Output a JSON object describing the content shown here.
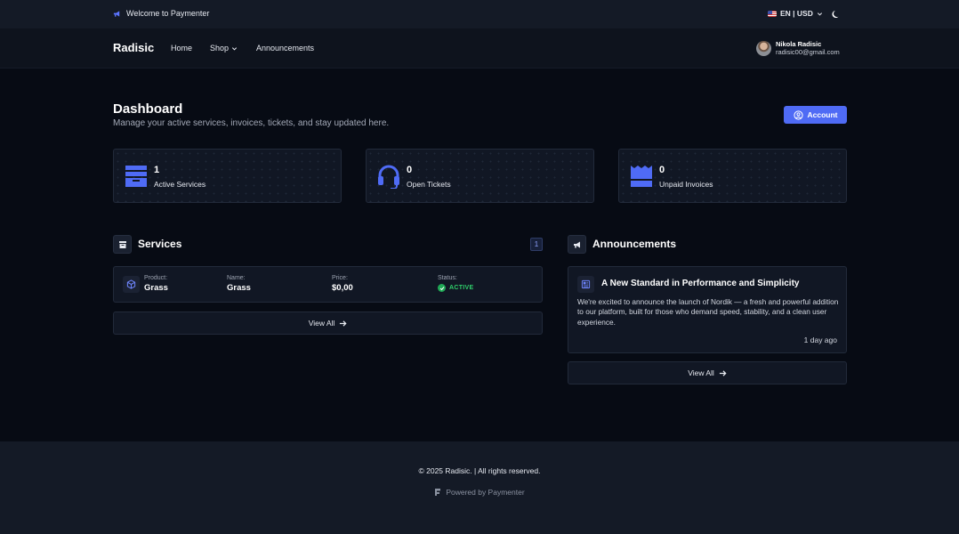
{
  "topbar": {
    "welcome": "Welcome to Paymenter",
    "locale": "EN | USD"
  },
  "navbar": {
    "brand": "Radisic",
    "links": [
      {
        "label": "Home"
      },
      {
        "label": "Shop"
      },
      {
        "label": "Announcements"
      }
    ],
    "user": {
      "name": "Nikola Radisic",
      "email": "radisic00@gmail.com"
    }
  },
  "header": {
    "title": "Dashboard",
    "subtitle": "Manage your active services, invoices, tickets, and stay updated here.",
    "account_button": "Account"
  },
  "stats": [
    {
      "value": "1",
      "label": "Active Services",
      "icon": "archive-box-icon"
    },
    {
      "value": "0",
      "label": "Open Tickets",
      "icon": "headset-icon"
    },
    {
      "value": "0",
      "label": "Unpaid Invoices",
      "icon": "invoice-icon"
    }
  ],
  "services": {
    "title": "Services",
    "count": "1",
    "items": [
      {
        "product_label": "Product:",
        "product": "Grass",
        "name_label": "Name:",
        "name": "Grass",
        "price_label": "Price:",
        "price": "$0,00",
        "status_label": "Status:",
        "status": "ACTIVE"
      }
    ],
    "view_all": "View All"
  },
  "announcements": {
    "title": "Announcements",
    "items": [
      {
        "title": "A New Standard in Performance and Simplicity",
        "body": "We're excited to announce the launch of Nordik — a fresh and powerful addition to our platform, built for those who demand speed, stability, and a clean user experience.",
        "time": "1 day ago"
      }
    ],
    "view_all": "View All"
  },
  "footer": {
    "copyright": "© 2025 Radisic. | All rights reserved.",
    "powered": "Powered by Paymenter"
  },
  "colors": {
    "accent": "#4f6bf5",
    "background": "#070b14",
    "card": "#111724",
    "active": "#2fcf6a"
  }
}
